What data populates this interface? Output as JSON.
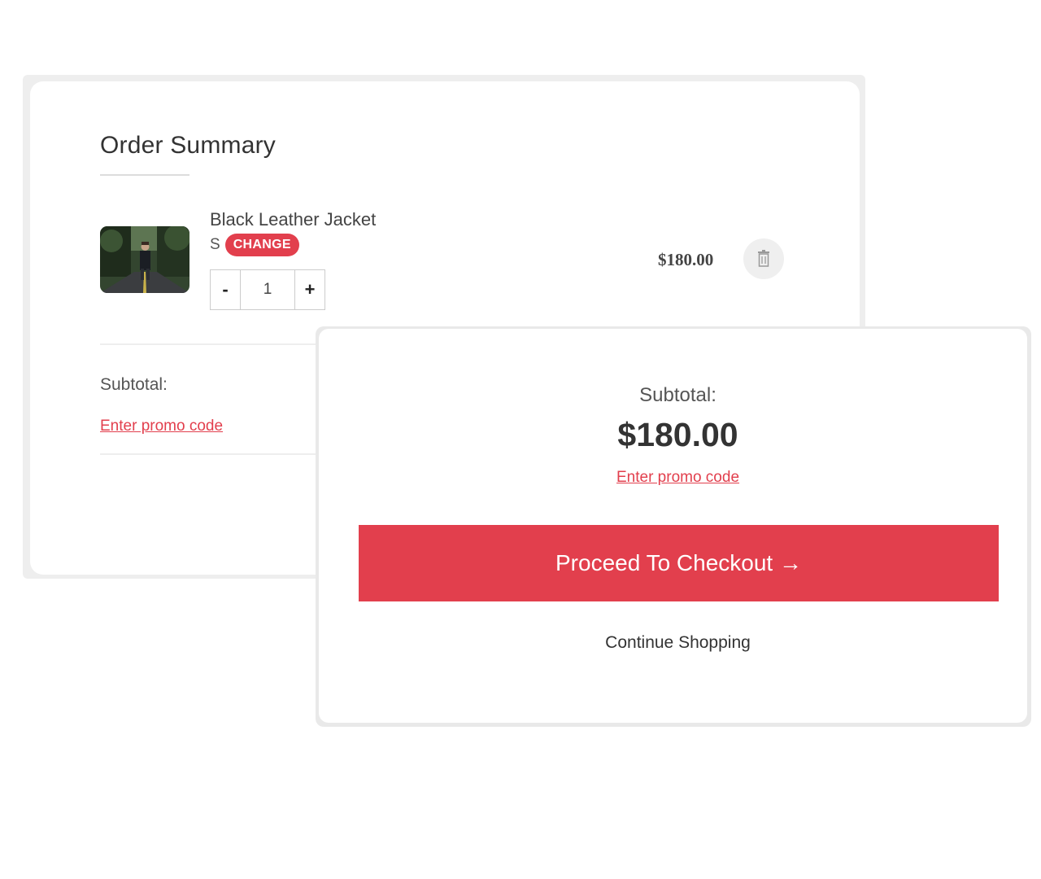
{
  "order_summary": {
    "title": "Order Summary",
    "item": {
      "name": "Black Leather Jacket",
      "size": "S",
      "change_label": "CHANGE",
      "quantity": "1",
      "decrement_label": "-",
      "increment_label": "+",
      "price": "$180.00",
      "image_icon": "product-photo-person-on-road",
      "delete_icon": "trash-icon"
    },
    "subtotal_label": "Subtotal:",
    "promo_link": "Enter promo code"
  },
  "checkout_panel": {
    "subtotal_label": "Subtotal:",
    "subtotal_amount": "$180.00",
    "promo_link": "Enter promo code",
    "checkout_button": "Proceed To Checkout →",
    "continue_link": "Continue Shopping"
  },
  "colors": {
    "accent": "#e23f4d",
    "text": "#333333",
    "muted_bg": "#efefef"
  }
}
